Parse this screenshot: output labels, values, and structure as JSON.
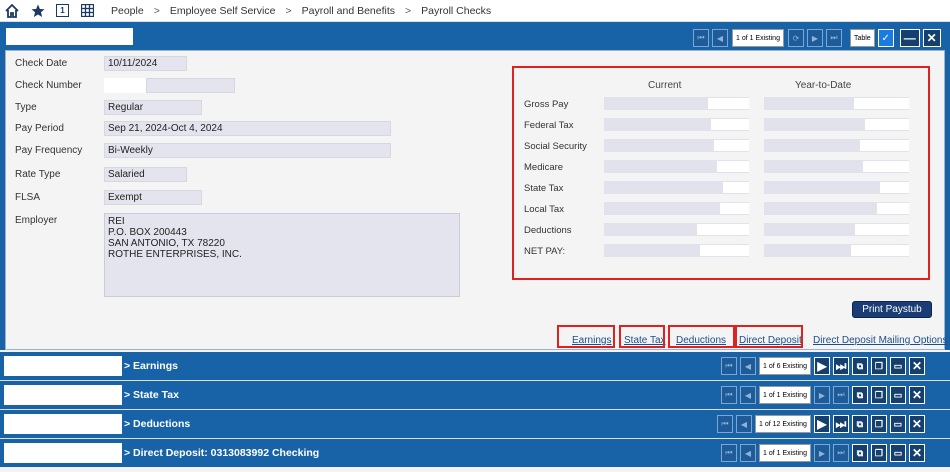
{
  "nav": {
    "breadcrumbs": [
      "People",
      "Employee Self Service",
      "Payroll and Benefits",
      "Payroll Checks"
    ],
    "sep": ">",
    "num_icon": "1"
  },
  "main_panel": {
    "pager": "1 of 1 Existing",
    "view_label": "Table",
    "check_mark": "✓"
  },
  "fields": {
    "check_date_label": "Check Date",
    "check_date": "10/11/2024",
    "check_number_label": "Check Number",
    "type_label": "Type",
    "type": "Regular",
    "pay_period_label": "Pay Period",
    "pay_period": "Sep 21, 2024-Oct 4, 2024",
    "pay_frequency_label": "Pay Frequency",
    "pay_frequency": "Bi-Weekly",
    "rate_type_label": "Rate Type",
    "rate_type": "Salaried",
    "flsa_label": "FLSA",
    "flsa": "Exempt",
    "employer_label": "Employer",
    "employer": "REI\nP.O. BOX 200443\nSAN ANTONIO, TX 78220\nROTHE ENTERPRISES, INC."
  },
  "totals": {
    "col_current": "Current",
    "col_ytd": "Year-to-Date",
    "rows": [
      {
        "label": "Gross Pay",
        "current_fill": 0.72,
        "ytd_fill": 0.62
      },
      {
        "label": "Federal Tax",
        "current_fill": 0.74,
        "ytd_fill": 0.7
      },
      {
        "label": "Social Security",
        "current_fill": 0.76,
        "ytd_fill": 0.66
      },
      {
        "label": "Medicare",
        "current_fill": 0.78,
        "ytd_fill": 0.68
      },
      {
        "label": "State Tax",
        "current_fill": 0.82,
        "ytd_fill": 0.8
      },
      {
        "label": "Local Tax",
        "current_fill": 0.8,
        "ytd_fill": 0.78
      },
      {
        "label": "Deductions",
        "current_fill": 0.64,
        "ytd_fill": 0.63
      },
      {
        "label": "NET PAY:",
        "current_fill": 0.66,
        "ytd_fill": 0.6
      }
    ]
  },
  "print_button": "Print Paystub",
  "links": [
    "Earnings",
    "State Tax",
    "Deductions",
    "Direct Deposit",
    "Direct Deposit Mailing Options"
  ],
  "sections": [
    {
      "title": "> Earnings",
      "pager": "1 of 6 Existing"
    },
    {
      "title": "> State Tax",
      "pager": "1 of 1 Existing"
    },
    {
      "title": "> Deductions",
      "pager": "1 of 12 Existing"
    },
    {
      "title": "> Direct Deposit:  0313083992  Checking",
      "pager": "1 of 1 Existing"
    }
  ]
}
